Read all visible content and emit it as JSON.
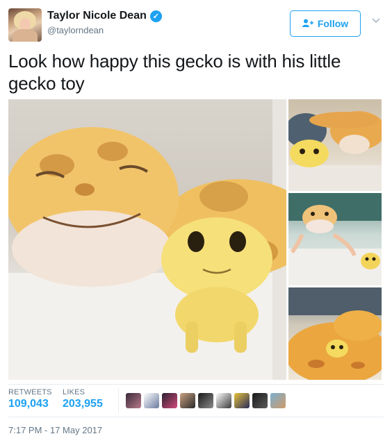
{
  "author": {
    "display_name": "Taylor Nicole Dean",
    "handle": "@taylorndean",
    "verified": true,
    "avatar_icon": "profile-photo"
  },
  "actions": {
    "follow_label": "Follow",
    "follow_icon": "add-user-icon",
    "menu_icon": "chevron-down-icon"
  },
  "tweet": {
    "text": "Look how happy this gecko is with his little gecko toy"
  },
  "media": [
    {
      "icon": "photo-smiling-gecko-with-toy"
    },
    {
      "icon": "photo-gecko-resting-with-toy"
    },
    {
      "icon": "photo-gecko-with-toy-on-sand"
    },
    {
      "icon": "photo-gecko-curled-around-toy"
    }
  ],
  "stats": {
    "retweets_label": "RETWEETS",
    "retweets_value": "109,043",
    "likes_label": "LIKES",
    "likes_value": "203,955"
  },
  "liker_avatars": 10,
  "timestamp": "7:17 PM - 17 May 2017",
  "colors": {
    "accent": "#1da1f2",
    "secondary_text": "#657786",
    "primary_text": "#14171a"
  }
}
